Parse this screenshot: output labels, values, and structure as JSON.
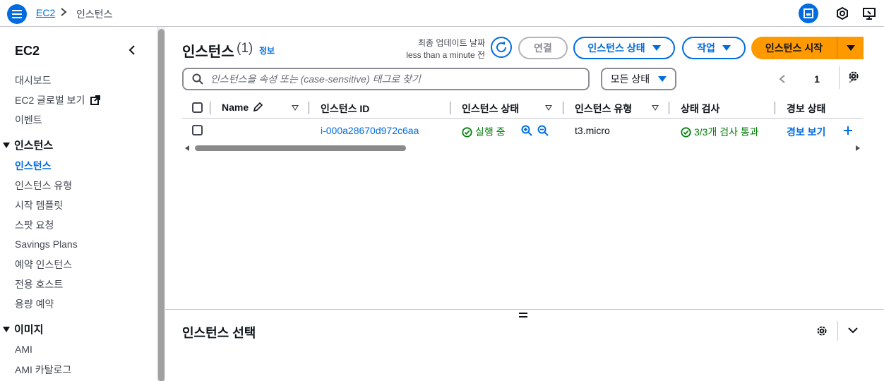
{
  "topbar": {
    "breadcrumb_root": "EC2",
    "breadcrumb_current": "인스턴스",
    "icons": [
      "menu-icon",
      "chevron-right-icon",
      "panel-icon",
      "cloudshell-icon",
      "feedback-icon"
    ]
  },
  "sidebar": {
    "title": "EC2",
    "items_top": [
      "대시보드",
      "EC2 글로벌 보기",
      "이벤트"
    ],
    "section_instances": "인스턴스",
    "instances_items": [
      "인스턴스",
      "인스턴스 유형",
      "시작 템플릿",
      "스팟 요청",
      "Savings Plans",
      "예약 인스턴스",
      "전용 호스트",
      "용량 예약"
    ],
    "active_item": "인스턴스",
    "section_images": "이미지",
    "images_items": [
      "AMI",
      "AMI 카탈로그"
    ]
  },
  "header": {
    "title": "인스턴스",
    "count": "(1)",
    "info": "정보",
    "updated_label": "최종 업데이트 날짜",
    "updated_value": "less than a minute 전"
  },
  "actions": {
    "connect": "연결",
    "instance_state": "인스턴스 상태",
    "actions": "작업",
    "launch": "인스턴스 시작"
  },
  "filter": {
    "search_placeholder": "인스턴스을 속성 또는 (case-sensitive) 태그로 찾기",
    "state_select": "모든 상태",
    "page": "1"
  },
  "table": {
    "columns": [
      "Name",
      "인스턴스 ID",
      "인스턴스 상태",
      "인스턴스 유형",
      "상태 검사",
      "경보 상태"
    ],
    "rows": [
      {
        "name": "",
        "instance_id": "i-000a28670d972c6aa",
        "state": "실행 중",
        "type": "t3.micro",
        "status_check": "3/3개 검사 통과",
        "alarm": "경보 보기"
      }
    ]
  },
  "bottom_panel": {
    "title": "인스턴스 선택"
  },
  "colors": {
    "accent": "#006ce0",
    "primary_button": "#ff9900",
    "success": "#037f0c",
    "text": "#0f141a",
    "muted": "#424650"
  }
}
